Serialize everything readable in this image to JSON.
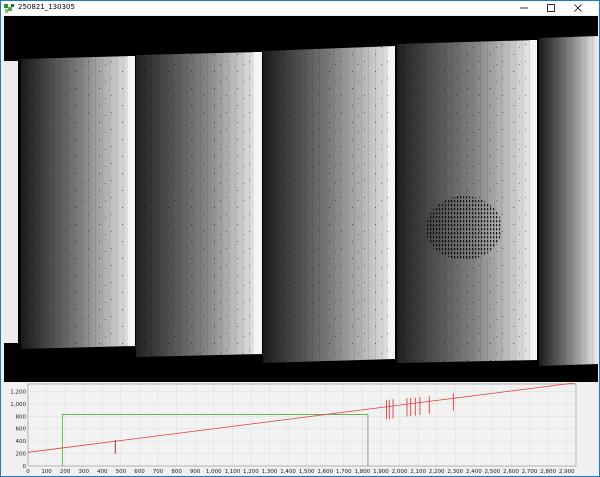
{
  "window": {
    "title": "250821_130305",
    "controls": {
      "minimize": "—",
      "maximize": "☐",
      "close": "✕"
    }
  },
  "histogram": {
    "colors": {
      "red": "#e23b3b",
      "green": "#4caf3a",
      "grid": "#b9b9b9",
      "background": "#f2f2f2"
    },
    "y_ticks": [
      "0",
      "200",
      "400",
      "600",
      "800",
      "1,000",
      "1,200"
    ],
    "x_ticks": [
      "0",
      "100",
      "200",
      "300",
      "400",
      "500",
      "600",
      "700",
      "800",
      "900",
      "1,000",
      "1,100",
      "1,200",
      "1,300",
      "1,400",
      "1,500",
      "1,600",
      "1,700",
      "1,800",
      "1,900",
      "2,000",
      "2,100",
      "2,200",
      "2,300",
      "2,400",
      "2,500",
      "2,600",
      "2,700",
      "2,800",
      "2,900"
    ],
    "xlim": [
      0,
      2950
    ],
    "ylim": [
      0,
      1320
    ]
  },
  "chart_data": {
    "type": "line",
    "x": [
      0,
      2950
    ],
    "series": [
      {
        "values": [
          220,
          1340
        ]
      }
    ],
    "lut_window": {
      "x_start": 185,
      "x_end": 1830,
      "y_level": 830
    },
    "spikes": [
      {
        "x": 470,
        "y_top": 420
      },
      {
        "x": 1930,
        "y_top": 1060
      },
      {
        "x": 1945,
        "y_top": 1070
      },
      {
        "x": 1965,
        "y_top": 1075
      },
      {
        "x": 2040,
        "y_top": 1090
      },
      {
        "x": 2060,
        "y_top": 1095
      },
      {
        "x": 2085,
        "y_top": 1100
      },
      {
        "x": 2110,
        "y_top": 1110
      },
      {
        "x": 2160,
        "y_top": 1125
      },
      {
        "x": 2290,
        "y_top": 1170
      }
    ]
  }
}
